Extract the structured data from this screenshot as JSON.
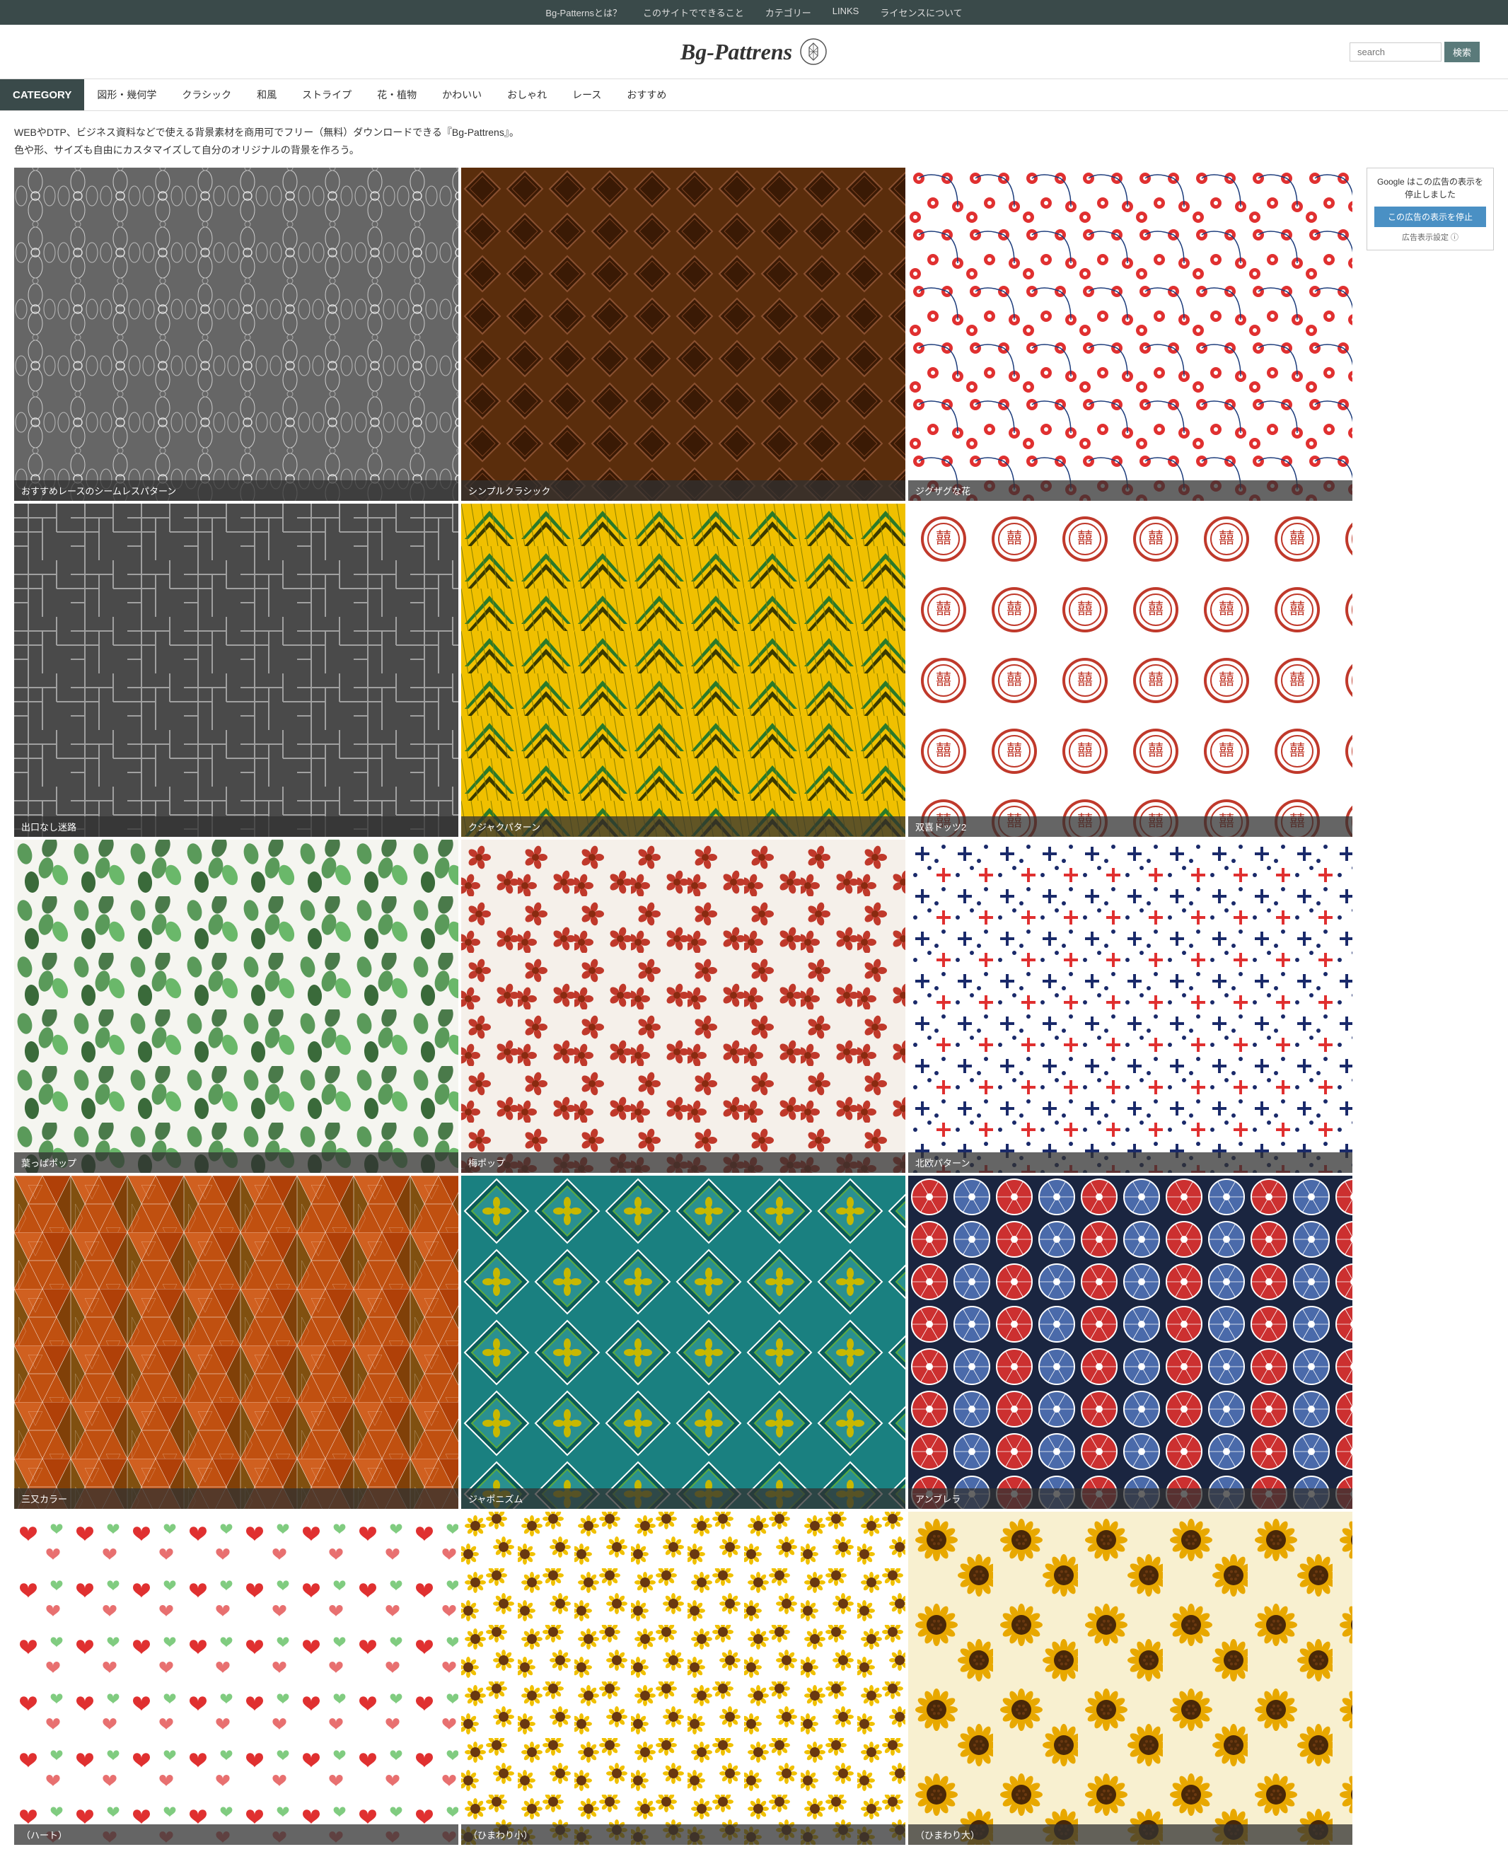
{
  "topnav": {
    "items": [
      {
        "label": "Bg-Patternsとは？",
        "id": "about"
      },
      {
        "label": "このサイトでできること",
        "id": "features"
      },
      {
        "label": "カテゴリー",
        "id": "categories"
      },
      {
        "label": "LINKS",
        "id": "links"
      },
      {
        "label": "ライセンスについて",
        "id": "license"
      }
    ]
  },
  "header": {
    "logo_text": "Bg-Pattrens",
    "search_placeholder": "search",
    "search_button": "検索"
  },
  "catnav": {
    "items": [
      {
        "label": "CATEGORY",
        "active": true
      },
      {
        "label": "図形・幾何学"
      },
      {
        "label": "クラシック"
      },
      {
        "label": "和風"
      },
      {
        "label": "ストライプ"
      },
      {
        "label": "花・植物"
      },
      {
        "label": "かわいい"
      },
      {
        "label": "おしゃれ"
      },
      {
        "label": "レース"
      },
      {
        "label": "おすすめ"
      }
    ]
  },
  "description": {
    "line1": "WEBやDTP、ビジネス資料などで使える背景素材を商用可でフリー（無料）ダウンロードできる『Bg-Pattrens』。",
    "line2": "色や形、サイズも自由にカスタマイズして自分のオリジナルの背景を作ろう。"
  },
  "patterns": [
    {
      "id": "p1",
      "label": "おすすめレースのシームレスパターン",
      "class": "p1"
    },
    {
      "id": "p2",
      "label": "シンプルクラシック",
      "class": "p2"
    },
    {
      "id": "p3",
      "label": "ジグザグな花",
      "class": "p3"
    },
    {
      "id": "p4",
      "label": "出口なし迷路",
      "class": "p4"
    },
    {
      "id": "p5",
      "label": "クジャクパターン",
      "class": "p5"
    },
    {
      "id": "p6",
      "label": "双喜ドッツ2",
      "class": "p6"
    },
    {
      "id": "p7",
      "label": "葉っぱポップ",
      "class": "p7"
    },
    {
      "id": "p8",
      "label": "梅ポップ",
      "class": "p8"
    },
    {
      "id": "p9",
      "label": "北欧パターン",
      "class": "p9"
    },
    {
      "id": "p10",
      "label": "三又カラー",
      "class": "p10"
    },
    {
      "id": "p11",
      "label": "ジャポニズム",
      "class": "p11"
    },
    {
      "id": "p12",
      "label": "アンブレラ",
      "class": "p12"
    },
    {
      "id": "p13",
      "label": "（ハート）",
      "class": "p13"
    },
    {
      "id": "p14",
      "label": "（ひまわり小）",
      "class": "p14"
    },
    {
      "id": "p15",
      "label": "（ひまわり大）",
      "class": "p15"
    }
  ],
  "ad": {
    "message": "Google はこの広告の表示を停止しました",
    "stop_button": "この広告の表示を停止",
    "settings_link": "広告表示設定 ⓘ"
  }
}
